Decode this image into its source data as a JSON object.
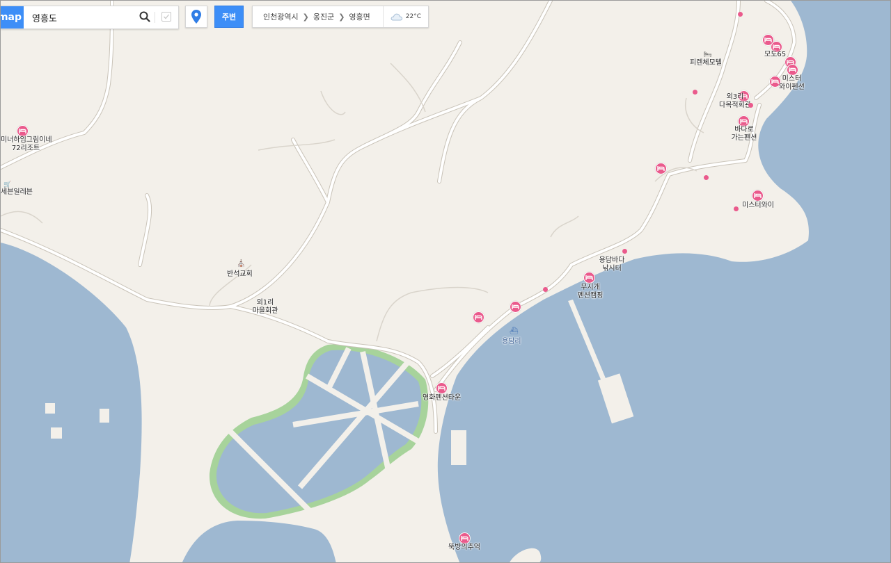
{
  "search": {
    "brand": "map",
    "query": "영흥도"
  },
  "toolbar": {
    "nearby_label": "주변"
  },
  "breadcrumb": {
    "city": "인천광역시",
    "county": "옹진군",
    "town": "영흥면"
  },
  "weather": {
    "temperature": "22°C"
  },
  "places": {
    "pension_resort": {
      "line1": "미너하임그림이네",
      "line2": "72리조트"
    },
    "seven_eleven": "세븐일레븐",
    "motel": "피렌체모텔",
    "modo65": "모도65",
    "misty_pension": {
      "line1": "미스터",
      "line2": "와이펜션"
    },
    "outer3": {
      "line1": "외3리",
      "line2": "다목적회관"
    },
    "to_sea_pension": {
      "line1": "바다로",
      "line2": "가는펜션"
    },
    "misty_y": "미스터와이",
    "yongdam_fishing": {
      "line1": "용담바다",
      "line2": "낚시터"
    },
    "rainbow_camping": {
      "line1": "무지개",
      "line2": "펜션캠핑"
    },
    "bansuk_church": "반석교회",
    "outer1_hall": {
      "line1": "외1리",
      "line2": "마을회관"
    },
    "yongdam_ri": "용담리",
    "younghwa_town": "영화펜션타운",
    "ttukbang": "뚝방의추억"
  },
  "colors": {
    "water": "#9eb8d1",
    "land": "#f3f0ea",
    "road": "#ffffff",
    "road_outline": "#c9c3b8",
    "poi": "#ea5a8c",
    "accent": "#3d8ef7",
    "green": "#a7d39b"
  }
}
